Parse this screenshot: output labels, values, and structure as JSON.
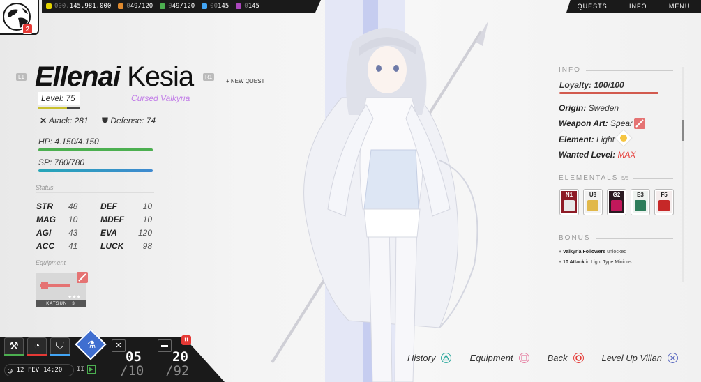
{
  "resources": [
    {
      "name": "credits",
      "dim": "000.",
      "value": "145.981.000",
      "color": "#e3d400"
    },
    {
      "name": "crates",
      "dim": "0",
      "value": "49/120",
      "color": "#e08a2e"
    },
    {
      "name": "minions",
      "dim": "0",
      "value": "49/120",
      "color": "#4caf50"
    },
    {
      "name": "energy",
      "dim": "00",
      "value": "145",
      "color": "#42a5f5"
    },
    {
      "name": "gems",
      "dim": "0",
      "value": "145",
      "color": "#ab47bc"
    }
  ],
  "notifications": "2",
  "nav": {
    "quests": "QUESTS",
    "info": "INFO",
    "menu": "MENU"
  },
  "character": {
    "first_name": "Ellenai",
    "last_name": "Kesia",
    "prev_tag": "L1",
    "next_tag": "R1",
    "new_quest": "+ NEW QUEST",
    "level_label": "Level: 75",
    "level_progress": 0.7,
    "class": "Cursed Valkyria",
    "atack": "Atack: 281",
    "defense": "Defense: 74",
    "hp": "HP: 4.150/4.150",
    "sp": "SP: 780/780",
    "hp_fraction": 1.0,
    "sp_fraction": 1.0
  },
  "status": {
    "label": "Status",
    "rows": [
      {
        "k1": "STR",
        "v1": "48",
        "k2": "DEF",
        "v2": "10"
      },
      {
        "k1": "MAG",
        "v1": "10",
        "k2": "MDEF",
        "v2": "10"
      },
      {
        "k1": "AGI",
        "v1": "43",
        "k2": "EVA",
        "v2": "120"
      },
      {
        "k1": "ACC",
        "v1": "41",
        "k2": "LUCK",
        "v2": "98"
      }
    ]
  },
  "equipment": {
    "label": "Equipment",
    "item_name": "KATSUN +3",
    "stars": "★★★"
  },
  "info": {
    "label": "INFO",
    "loyalty": "Loyalty: 100/100",
    "loyalty_fraction": 1.0,
    "origin_k": "Origin:",
    "origin_v": "Sweden",
    "weapon_k": "Weapon Art:",
    "weapon_v": "Spear",
    "element_k": "Element:",
    "element_v": "Light",
    "wanted_k": "Wanted Level:",
    "wanted_v": "MAX"
  },
  "elementals": {
    "label": "ELEMENTALS",
    "count": "5/5",
    "cards": [
      {
        "code": "N1",
        "bg": "#8e1b26",
        "fg": "#fff",
        "img": "#e8e8e8"
      },
      {
        "code": "U8",
        "bg": "#f2f2f2",
        "fg": "#222",
        "img": "#e1b84a"
      },
      {
        "code": "G2",
        "bg": "#2a1a22",
        "fg": "#fff",
        "img": "#c2185b"
      },
      {
        "code": "E3",
        "bg": "#eef3f0",
        "fg": "#222",
        "img": "#2e7d5b"
      },
      {
        "code": "F5",
        "bg": "#f5eded",
        "fg": "#222",
        "img": "#c62828"
      }
    ]
  },
  "bonus": {
    "label": "BONUS",
    "line1_bold": "Valkyria Followers",
    "line1_rest": "unlocked",
    "line2_bold": "10 Attack",
    "line2_rest": "in Light Type Minions"
  },
  "bottom": {
    "date": "12 FEV",
    "time": "14:20",
    "pause": "II",
    "counter1": "05",
    "counter1_sub": "/10",
    "counter2": "20",
    "counter2_sub": "/92",
    "alert": "!!"
  },
  "actions": [
    {
      "label": "History",
      "button": "triangle",
      "color": "#26a69a"
    },
    {
      "label": "Equipment",
      "button": "square",
      "color": "#e57ca0"
    },
    {
      "label": "Back",
      "button": "circle",
      "color": "#e53935"
    },
    {
      "label": "Level Up Villan",
      "button": "cross",
      "color": "#5c6bc0"
    }
  ]
}
